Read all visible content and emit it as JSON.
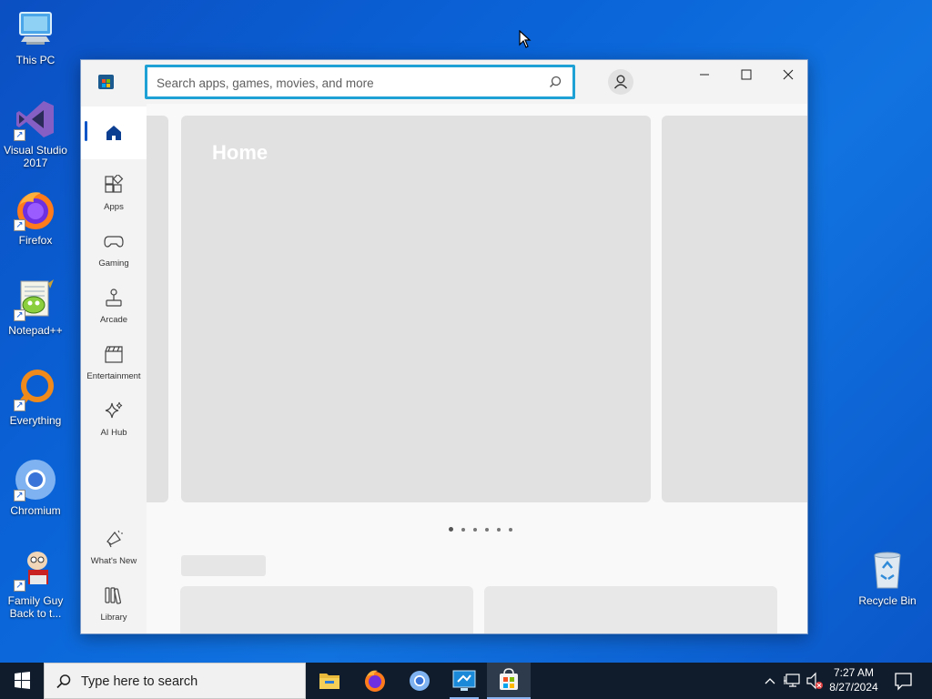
{
  "desktop": {
    "icons": [
      {
        "label": "This PC",
        "icon": "computer-icon"
      },
      {
        "label": "Visual Studio 2017",
        "icon": "visual-studio-icon"
      },
      {
        "label": "Firefox",
        "icon": "firefox-icon"
      },
      {
        "label": "Notepad++",
        "icon": "notepadpp-icon"
      },
      {
        "label": "Everything",
        "icon": "everything-icon"
      },
      {
        "label": "Chromium",
        "icon": "chromium-icon"
      },
      {
        "label": "Family Guy Back to t...",
        "icon": "family-guy-icon"
      },
      {
        "label": "Recycle Bin",
        "icon": "recycle-bin-icon"
      }
    ]
  },
  "store_window": {
    "search": {
      "placeholder": "Search apps, games, movies, and more"
    },
    "nav": {
      "items": [
        {
          "label": "",
          "icon": "home-icon",
          "active": true
        },
        {
          "label": "Apps",
          "icon": "apps-icon"
        },
        {
          "label": "Gaming",
          "icon": "gamepad-icon"
        },
        {
          "label": "Arcade",
          "icon": "joystick-icon"
        },
        {
          "label": "Entertainment",
          "icon": "clapperboard-icon"
        },
        {
          "label": "AI Hub",
          "icon": "sparkle-icon"
        }
      ],
      "bottom": [
        {
          "label": "What's New",
          "icon": "megaphone-icon"
        },
        {
          "label": "Library",
          "icon": "library-icon"
        }
      ]
    },
    "hero": {
      "title": "Home"
    },
    "carousel": {
      "count": 6,
      "active_index": 0
    }
  },
  "taskbar": {
    "search_placeholder": "Type here to search",
    "apps": [
      "file-explorer-icon",
      "firefox-icon",
      "chromium-icon",
      "remote-desktop-icon",
      "microsoft-store-icon"
    ],
    "clock": {
      "time": "7:27 AM",
      "date": "8/27/2024"
    }
  }
}
